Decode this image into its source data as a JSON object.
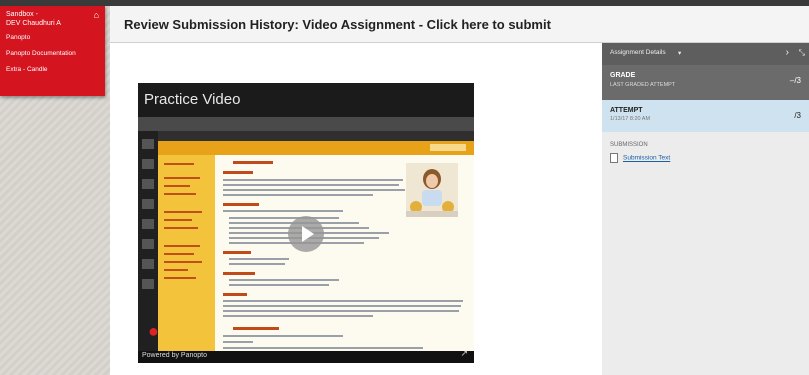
{
  "nav": {
    "course": "Sandbox -\nDEV Chaudhuri A",
    "items": [
      "Panopto",
      "Panopto Documentation",
      "Extra - Candle"
    ]
  },
  "page": {
    "title": "Review Submission History: Video Assignment - Click here to submit"
  },
  "video": {
    "title": "Practice Video",
    "powered_by": "Powered by Panopto"
  },
  "sidebar": {
    "header": "Assignment Details",
    "grade_label": "GRADE",
    "grade_sub": "LAST GRADED ATTEMPT",
    "grade_value": "–/3",
    "attempt_label": "ATTEMPT",
    "attempt_sub": "1/13/17 8:20 AM",
    "attempt_value": "/3",
    "submission_heading": "SUBMISSION",
    "submission_link": "Submission Text"
  },
  "colors": {
    "accent": "#d4141f",
    "link": "#1a5ea8",
    "attempt_bg": "#cfe2ef"
  },
  "icons": [
    "home-icon",
    "play-icon",
    "document-icon",
    "chevron-down-icon",
    "chevron-right-icon",
    "expand-icon"
  ]
}
